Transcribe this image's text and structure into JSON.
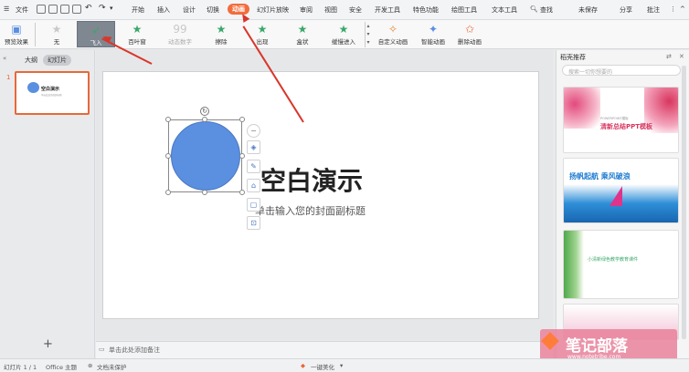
{
  "menubar": {
    "file": "文件",
    "items": [
      "开始",
      "插入",
      "设计",
      "切换",
      "动画",
      "幻灯片放映",
      "审阅",
      "视图",
      "安全",
      "开发工具",
      "特色功能",
      "绘图工具",
      "文本工具"
    ],
    "search": "查找",
    "unsaved": "未保存",
    "share": "分享",
    "comment": "批注"
  },
  "ribbon": {
    "preview": "预览效果",
    "effects": [
      "无",
      "飞入",
      "百叶窗",
      "动态数字",
      "擦除",
      "出现",
      "盒状",
      "缓慢进入"
    ],
    "custom": "自定义动画",
    "smart": "智能动画",
    "delete": "删除动画"
  },
  "leftpanel": {
    "tab_outline": "大纲",
    "tab_slides": "幻灯片",
    "slide_number": "1",
    "thumb_title": "空白演示",
    "thumb_sub": "单击此处添加副标题"
  },
  "slide": {
    "title": "空白演示",
    "subtitle": "单击输入您的封面副标题"
  },
  "notes": "单击此处添加备注",
  "rightpane": {
    "title": "稻壳推荐",
    "search_placeholder": "搜索一切你想要的",
    "tpl1_title": "清新总结PPT模板",
    "tpl1_small": "POWERPOINT模板",
    "tpl2_title": "扬帆起航 乘风破浪",
    "tpl3_title": "小清新绿色教学教育课件"
  },
  "statusbar": {
    "slide_count": "幻灯片 1 / 1",
    "theme": "Office 主题",
    "protect": "文档未保护",
    "beautify": "一键美化"
  },
  "watermark": {
    "name": "笔记部落",
    "url": "www.notetribe.com"
  },
  "colors": {
    "accent": "#f26d3d",
    "selected_effect": "#7f8791",
    "ellipse": "#5b8fe0",
    "arrow": "#d9362b"
  }
}
